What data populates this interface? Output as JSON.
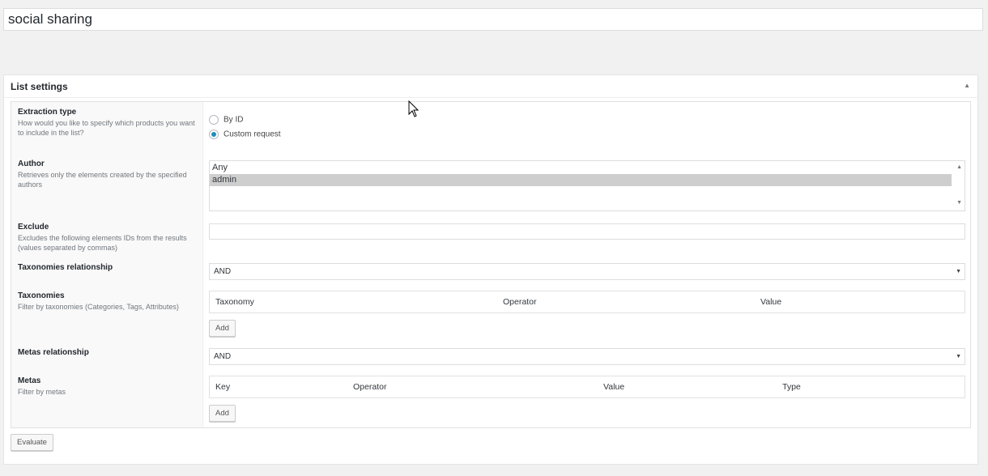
{
  "title_value": "social sharing",
  "postbox": {
    "title": "List settings",
    "toggle_glyph": "▲"
  },
  "fields": {
    "extraction": {
      "label": "Extraction type",
      "description": "How would you like to specify which products you want to include in the list?",
      "options": [
        {
          "label": "By ID",
          "checked": false
        },
        {
          "label": "Custom request",
          "checked": true
        }
      ]
    },
    "author": {
      "label": "Author",
      "description": "Retrieves only the elements created by the specified authors",
      "options": [
        "Any",
        "admin"
      ],
      "selected": "admin"
    },
    "exclude": {
      "label": "Exclude",
      "description": "Excludes the following elements IDs from the results (values separated by commas)",
      "value": ""
    },
    "tax_relationship": {
      "label": "Taxonomies relationship",
      "value": "AND"
    },
    "taxonomies": {
      "label": "Taxonomies",
      "description": "Filter by taxonomies (Categories, Tags, Attributes)",
      "columns": [
        "Taxonomy",
        "Operator",
        "Value"
      ],
      "add_label": "Add"
    },
    "meta_relationship": {
      "label": "Metas relationship",
      "value": "AND"
    },
    "metas": {
      "label": "Metas",
      "description": "Filter by metas",
      "columns": [
        "Key",
        "Operator",
        "Value",
        "Type"
      ],
      "add_label": "Add"
    }
  },
  "evaluate_label": "Evaluate",
  "icons": {
    "toggle": "arrow-up-icon",
    "select_arrow": "caret-down-icon",
    "cursor": "mouse-pointer-icon"
  }
}
